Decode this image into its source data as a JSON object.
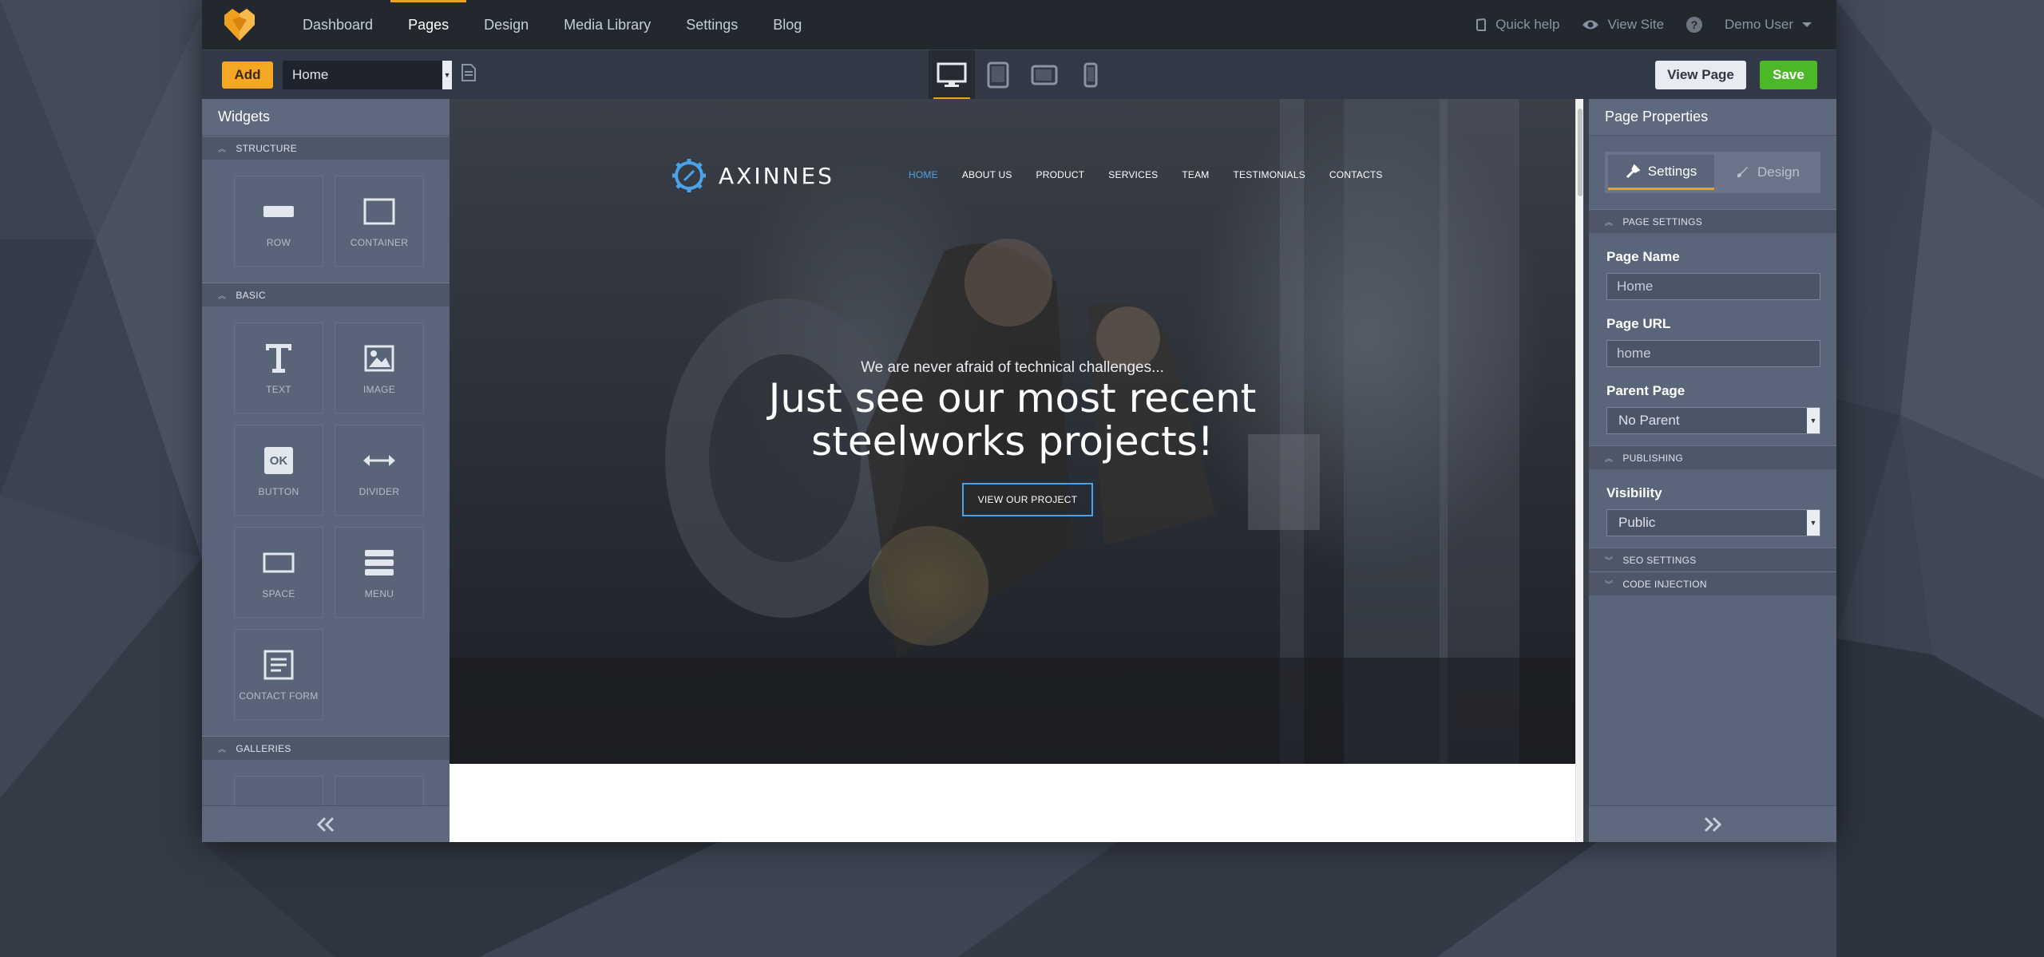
{
  "topnav": {
    "items": [
      {
        "label": "Dashboard"
      },
      {
        "label": "Pages"
      },
      {
        "label": "Design"
      },
      {
        "label": "Media Library"
      },
      {
        "label": "Settings"
      },
      {
        "label": "Blog"
      }
    ],
    "active_item": "Pages",
    "quick_help": "Quick help",
    "view_site": "View Site",
    "help_symbol": "?",
    "user": "Demo User"
  },
  "toolbar": {
    "add_label": "Add",
    "page_select_value": "Home",
    "devices": [
      "desktop-icon",
      "tablet-icon",
      "tablet-landscape-icon",
      "phone-icon"
    ],
    "view_page_label": "View Page",
    "save_label": "Save"
  },
  "widgets": {
    "title": "Widgets",
    "sections": {
      "structure": "STRUCTURE",
      "basic": "BASIC",
      "galleries": "GALLERIES"
    },
    "structure_items": [
      "ROW",
      "CONTAINER"
    ],
    "basic_items": [
      "TEXT",
      "IMAGE",
      "BUTTON",
      "DIVIDER",
      "SPACE",
      "MENU",
      "CONTACT FORM"
    ],
    "ok_text": "OK"
  },
  "preview": {
    "brand": "AXINNES",
    "nav": [
      "HOME",
      "ABOUT US",
      "PRODUCT",
      "SERVICES",
      "TEAM",
      "TESTIMONIALS",
      "CONTACTS"
    ],
    "subtitle": "We are never afraid of technical challenges...",
    "title_line1": "Just see our most recent",
    "title_line2": "steelworks projects!",
    "cta": "VIEW OUR PROJECT"
  },
  "properties": {
    "title": "Page Properties",
    "tab_settings": "Settings",
    "tab_design": "Design",
    "page_settings": "PAGE SETTINGS",
    "page_name_label": "Page Name",
    "page_name_value": "Home",
    "page_url_label": "Page URL",
    "page_url_value": "home",
    "parent_page_label": "Parent Page",
    "parent_page_value": "No Parent",
    "publishing": "PUBLISHING",
    "visibility_label": "Visibility",
    "visibility_value": "Public",
    "seo_settings": "SEO SETTINGS",
    "code_injection": "CODE INJECTION"
  },
  "colors": {
    "accent": "#f0a020",
    "add_button": "#f5a623",
    "save_button": "#4cb828",
    "site_accent": "#4aa3e8"
  }
}
